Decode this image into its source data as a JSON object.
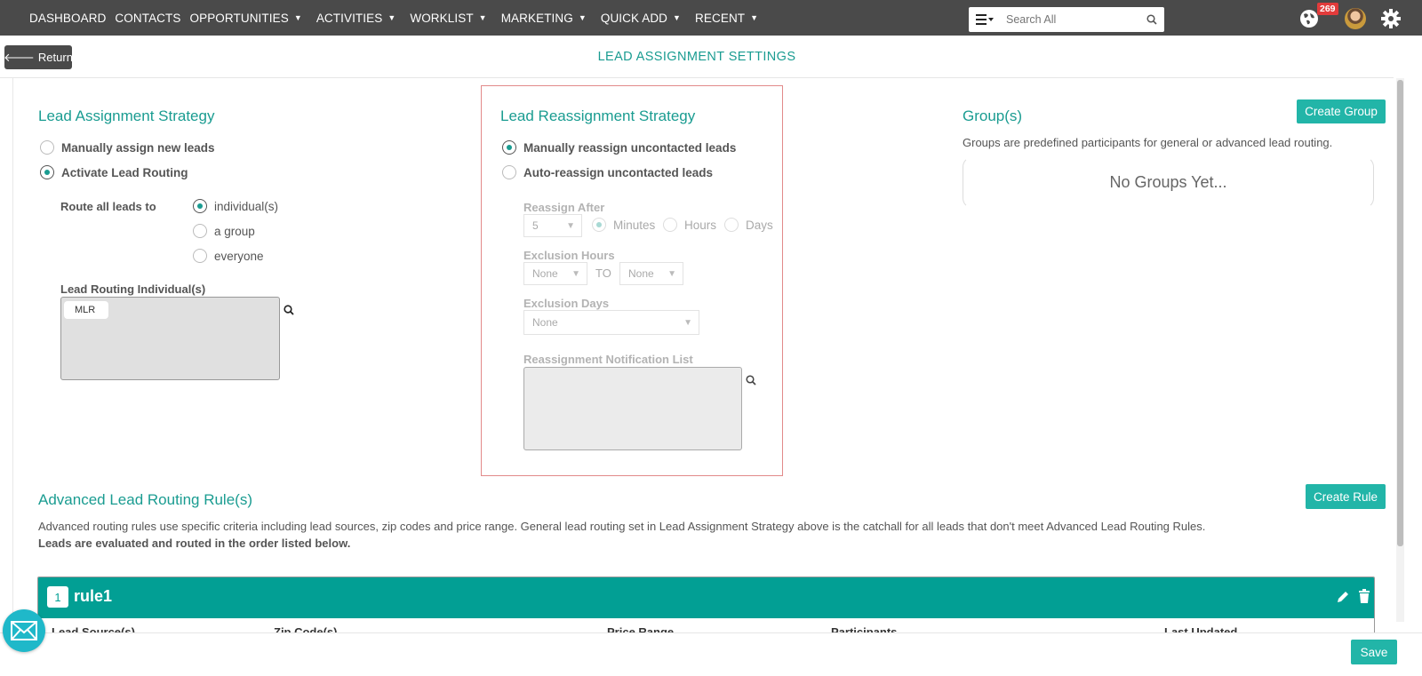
{
  "nav": {
    "items": [
      {
        "label": "DASHBOARD",
        "caret": false
      },
      {
        "label": "CONTACTS",
        "caret": false
      },
      {
        "label": "OPPORTUNITIES",
        "caret": true
      },
      {
        "label": "ACTIVITIES",
        "caret": true
      },
      {
        "label": "WORKLIST",
        "caret": true
      },
      {
        "label": "MARKETING",
        "caret": true
      },
      {
        "label": "QUICK ADD",
        "caret": true
      },
      {
        "label": "RECENT",
        "caret": true
      }
    ],
    "search_placeholder": "Search All",
    "notification_count": "269"
  },
  "header": {
    "return_label": "Return",
    "title": "LEAD ASSIGNMENT SETTINGS"
  },
  "assignment": {
    "heading": "Lead Assignment Strategy",
    "option_manual": "Manually assign new leads",
    "option_routing": "Activate Lead Routing",
    "selected": "routing",
    "route_label": "Route all leads to",
    "route_individual": "individual(s)",
    "route_group": "a group",
    "route_everyone": "everyone",
    "individuals_label": "Lead Routing Individual(s)",
    "individuals": [
      "MLR"
    ]
  },
  "reassignment": {
    "heading": "Lead Reassignment Strategy",
    "option_manual": "Manually reassign uncontacted leads",
    "option_auto": "Auto-reassign uncontacted leads",
    "reassign_after_label": "Reassign After",
    "reassign_after_value": "5",
    "unit_minutes": "Minutes",
    "unit_hours": "Hours",
    "unit_days": "Days",
    "exclusion_hours_label": "Exclusion Hours",
    "exclusion_from": "None",
    "to_label": "TO",
    "exclusion_to": "None",
    "exclusion_days_label": "Exclusion Days",
    "exclusion_days_value": "None",
    "notification_label": "Reassignment Notification List"
  },
  "groups": {
    "heading": "Group(s)",
    "create_label": "Create Group",
    "description": "Groups are predefined participants for general or advanced lead routing.",
    "empty_text": "No Groups Yet..."
  },
  "advanced": {
    "heading": "Advanced Lead Routing Rule(s)",
    "create_label": "Create Rule",
    "description": "Advanced routing rules use specific criteria including lead sources, zip codes and price range. General lead routing set in Lead Assignment Strategy above is the catchall for all leads that don't meet Advanced Lead Routing Rules.",
    "order_note": "Leads are evaluated and routed in the order listed below.",
    "rules": [
      {
        "number": "1",
        "name": "rule1"
      }
    ],
    "columns": [
      "Lead Source(s)",
      "Zip Code(s)",
      "Price Range",
      "Participants",
      "Last Updated"
    ]
  },
  "footer": {
    "save_label": "Save"
  },
  "colors": {
    "accent": "#1a9c91",
    "button": "#22b5a8",
    "rule_header": "#029f94",
    "nav_bg": "#4a4a4a",
    "badge": "#e23b3b"
  }
}
